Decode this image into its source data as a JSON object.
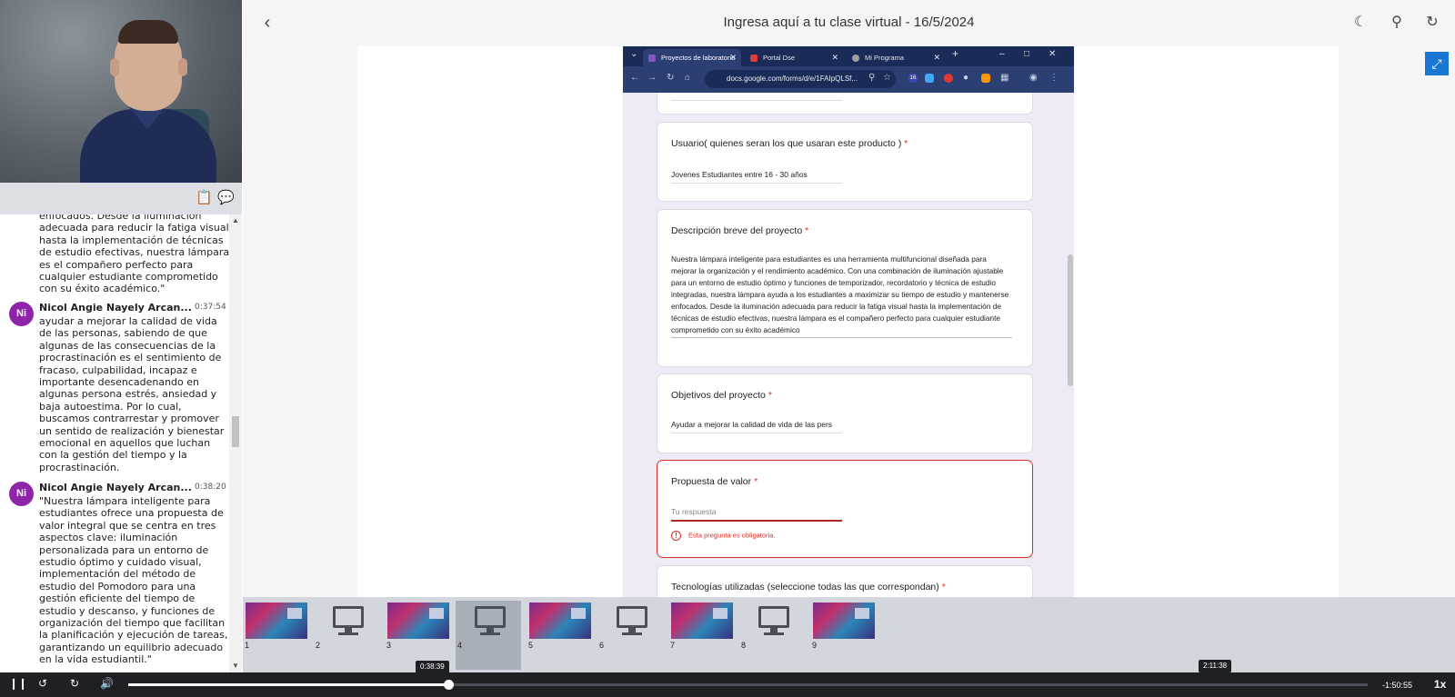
{
  "header": {
    "title": "Ingresa aquí a tu clase virtual - 16/5/2024"
  },
  "chat": {
    "continuation_text": "enfocados. Desde la iluminación adecuada para reducir la fatiga visual hasta la implementación de técnicas de estudio efectivas, nuestra lámpara es el compañero perfecto para cualquier estudiante comprometido con su éxito académico.\"",
    "messages": [
      {
        "initials": "Ni",
        "name": "Nicol Angie Nayely Arcan...",
        "time": "0:37:54",
        "text": "ayudar a mejorar la calidad de vida de las personas, sabiendo de que algunas de las consecuencias de la procrastinación es el sentimiento de fracaso, culpabilidad, incapaz e importante desencadenando en algunas persona estrés, ansiedad y baja autoestima. Por lo cual, buscamos contrarrestar y promover un sentido de realización y bienestar emocional en aquellos que luchan con la gestión del tiempo y la procrastinación."
      },
      {
        "initials": "Ni",
        "name": "Nicol Angie Nayely Arcan...",
        "time": "0:38:20",
        "text": "\"Nuestra lámpara inteligente para estudiantes ofrece una propuesta de valor integral que se centra en tres aspectos clave: iluminación personalizada para un entorno de estudio óptimo y cuidado visual, implementación del método de estudio del Pomodoro para una gestión eficiente del tiempo de estudio y descanso, y funciones de organización del tiempo que facilitan la planificación y ejecución de tareas, garantizando un equilibrio adecuado en la vida estudiantil.\""
      }
    ]
  },
  "browser": {
    "tabs": [
      {
        "label": "Proyectos de laboratorio",
        "active": true
      },
      {
        "label": "Portal Dse",
        "active": false
      },
      {
        "label": "Mi Programa",
        "active": false
      }
    ],
    "new_tab": "+",
    "url": "docs.google.com/forms/d/e/1FAIpQLSf...",
    "extension_badge": "16"
  },
  "form": {
    "questions": [
      {
        "label": "Usuario( quienes seran los que usaran este producto )",
        "required": "*",
        "answer": "Jovenes Estudiantes entre 16 - 30 años"
      },
      {
        "label": "Descripción breve del proyecto",
        "required": "*",
        "answer": "Nuestra lámpara inteligente para estudiantes es una herramienta multifuncional diseñada para mejorar la organización y el rendimiento académico. Con una combinación de iluminación ajustable para un entorno de estudio óptimo y funciones de temporizador, recordatorio y técnica de estudio integradas, nuestra lámpara ayuda a los estudiantes a maximizar su tiempo de estudio y mantenerse enfocados. Desde la iluminación adecuada para reducir la fatiga visual hasta la implementación de técnicas de estudio efectivas, nuestra lámpara es el compañero perfecto para cualquier estudiante comprometido con su éxito académico"
      },
      {
        "label": "Objetivos del proyecto",
        "required": "*",
        "answer": "Ayudar a mejorar la calidad de vida de las pers"
      },
      {
        "label": "Propuesta de valor",
        "required": "*",
        "placeholder": "Tu respuesta",
        "error": "Esta pregunta es obligatoria."
      },
      {
        "label": "Tecnologías utilizadas (seleccione todas las que correspondan)",
        "required": "*"
      }
    ]
  },
  "thumbnails": {
    "items": [
      {
        "num": "1",
        "kind": "art"
      },
      {
        "num": "2",
        "kind": "screen"
      },
      {
        "num": "3",
        "kind": "art"
      },
      {
        "num": "4",
        "kind": "screen",
        "selected": true
      },
      {
        "num": "5",
        "kind": "art"
      },
      {
        "num": "6",
        "kind": "screen"
      },
      {
        "num": "7",
        "kind": "art"
      },
      {
        "num": "8",
        "kind": "screen"
      },
      {
        "num": "9",
        "kind": "art"
      }
    ]
  },
  "player": {
    "current_time_tip": "0:38:39",
    "hover_time_tip": "2:11:38",
    "remaining": "-1:50:55",
    "speed": "1x",
    "progress_fraction": 0.258
  },
  "colors": {
    "accent": "#1976d2",
    "avatar": "#8e24aa",
    "error": "#d93025",
    "tabbar": "#1a2b57"
  }
}
